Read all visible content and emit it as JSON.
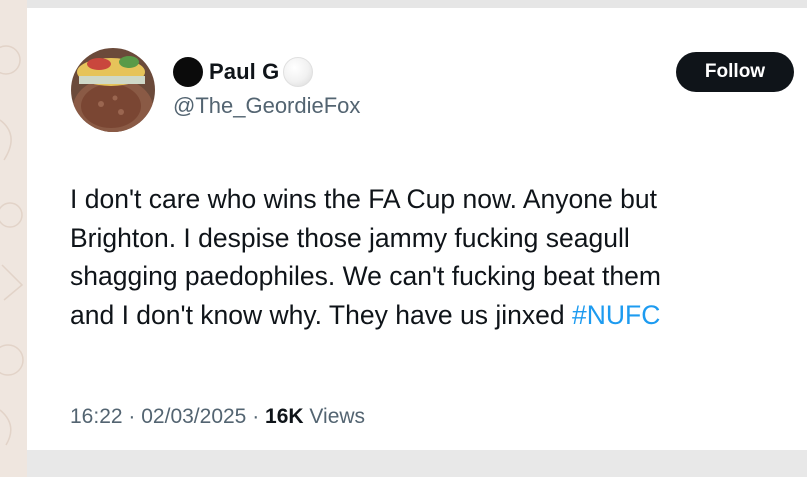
{
  "user": {
    "display_name": "Paul G",
    "handle": "@The_GeordieFox",
    "avatar_icon": "burger-avatar"
  },
  "follow_button": {
    "label": "Follow"
  },
  "tweet": {
    "lines": [
      "I don't care who wins the FA Cup now. Anyone but",
      "Brighton. I despise those jammy fucking seagull",
      "shagging paedophiles. We can't fucking beat them",
      "and I don't know why. They have us jinxed "
    ],
    "hashtag": "#NUFC"
  },
  "meta": {
    "time": "16:22",
    "separator": "·",
    "date": "02/03/2025",
    "views_count": "16K",
    "views_label": "Views"
  },
  "colors": {
    "text": "#0f1419",
    "secondary": "#536471",
    "link": "#1d9bf0",
    "button_bg": "#0f1419"
  }
}
